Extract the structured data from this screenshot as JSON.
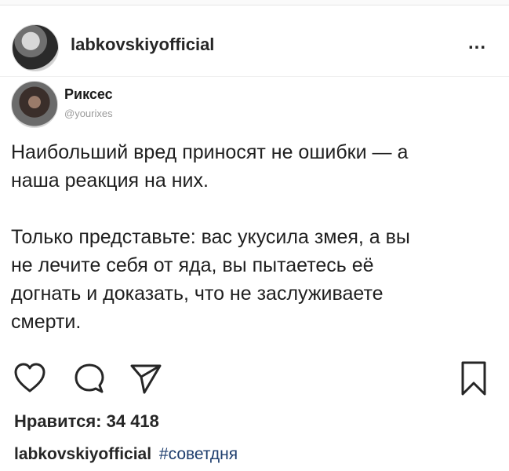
{
  "post": {
    "username": "labkovskiyofficial",
    "more": "..."
  },
  "tweet": {
    "name": "Риксес",
    "handle": "@yourixes",
    "text": "Наибольший вред приносят не ошибки — а\nнаша реакция на них.\n\nТолько представьте: вас укусила змея, а вы\nне лечите себя от яда, вы пытаетесь её\nдогнать и доказать, что не заслуживаете\nсмерти."
  },
  "actions": {
    "icons": [
      "heart-icon",
      "comment-icon",
      "share-icon",
      "bookmark-icon"
    ]
  },
  "likes": {
    "text": "Нравится: 34 418"
  },
  "caption": {
    "username": "labkovskiyofficial",
    "hashtag": "#советдня"
  }
}
